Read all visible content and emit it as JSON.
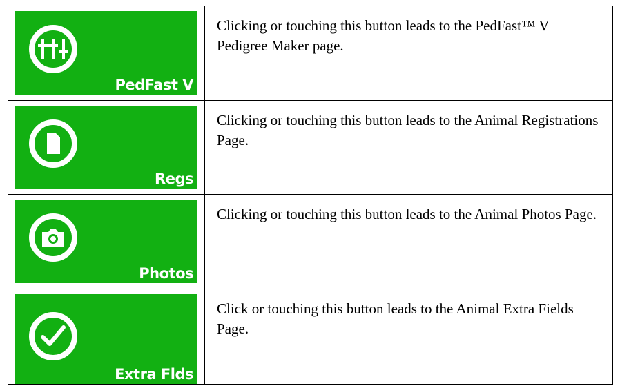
{
  "rows": [
    {
      "button_label": "PedFast V",
      "icon": "sliders-icon",
      "description": "Clicking or touching this button leads to the PedFast™ V Pedigree Maker page."
    },
    {
      "button_label": "Regs",
      "icon": "document-icon",
      "description": "Clicking or touching this button leads to the Animal Registrations Page."
    },
    {
      "button_label": "Photos",
      "icon": "camera-icon",
      "description": "Clicking or touching this button leads to the Animal Photos Page."
    },
    {
      "button_label": "Extra Flds",
      "icon": "checkmark-icon",
      "description": "Click or touching this button leads to the Animal Extra Fields Page."
    }
  ],
  "colors": {
    "tile": "#12b012",
    "icon": "#ffffff",
    "border": "#000000"
  }
}
